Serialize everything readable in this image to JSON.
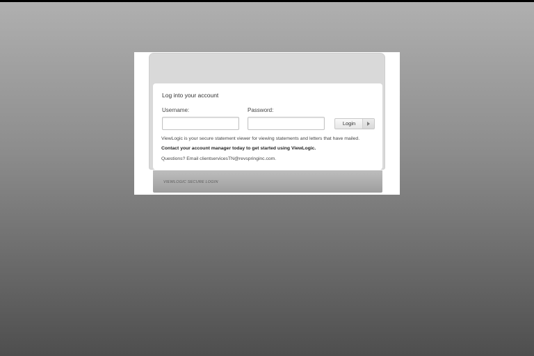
{
  "login_card": {
    "title": "Log into your account",
    "username_label": "Username:",
    "username_value": "",
    "password_label": "Password:",
    "password_value": "",
    "login_button_label": "Login",
    "description": "ViewLogic is your secure statement viewer for viewing statements and letters that have mailed.",
    "cta": "Contact your account manager today to get started using ViewLogic.",
    "questions": "Questions? Email clientservicesTN@revspringinc.com."
  },
  "footer": {
    "text": "VIEWLOGIC SECURE LOGIN"
  },
  "icons": {
    "login_arrow": "arrow-right-icon"
  },
  "colors": {
    "background_top": "#b0b0b0",
    "background_bottom": "#4e4e4e",
    "panel": "#d9d9d9",
    "footer": "#a8a8a8"
  }
}
